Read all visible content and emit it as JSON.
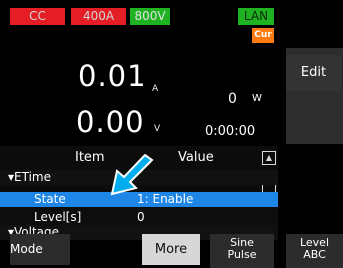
{
  "status_bar": {
    "mode": "CC",
    "range_current": "400A",
    "range_voltage": "800V",
    "network": "LAN",
    "cut_indicator": "Cur"
  },
  "measurements": {
    "current_value": "0.01",
    "current_unit": "A",
    "voltage_value": "0.00",
    "voltage_unit": "V",
    "power_value": "0",
    "power_unit": "W",
    "elapsed_time": "0:00:00"
  },
  "side_buttons": {
    "edit_label": "Edit"
  },
  "table": {
    "headers": {
      "item": "Item",
      "value": "Value"
    },
    "groups": [
      {
        "label": "▾ETime",
        "rows": [
          {
            "item": "State",
            "value": "1: Enable",
            "selected": true
          },
          {
            "item": "Level[s]",
            "value": "0",
            "selected": false
          }
        ]
      },
      {
        "label": "▾Voltage",
        "rows": []
      }
    ]
  },
  "bottom_buttons": {
    "mode_label": "Mode",
    "more_label": "More",
    "sine_line1": "Sine",
    "sine_line2": "Pulse",
    "level_line1": "Level",
    "level_line2": "ABC"
  },
  "colors": {
    "status_red": "#e51d24",
    "status_green": "#1fb322",
    "cut_orange": "#ff7a12",
    "selection_blue": "#1d86e6",
    "arrow_blue": "#00aeef"
  }
}
